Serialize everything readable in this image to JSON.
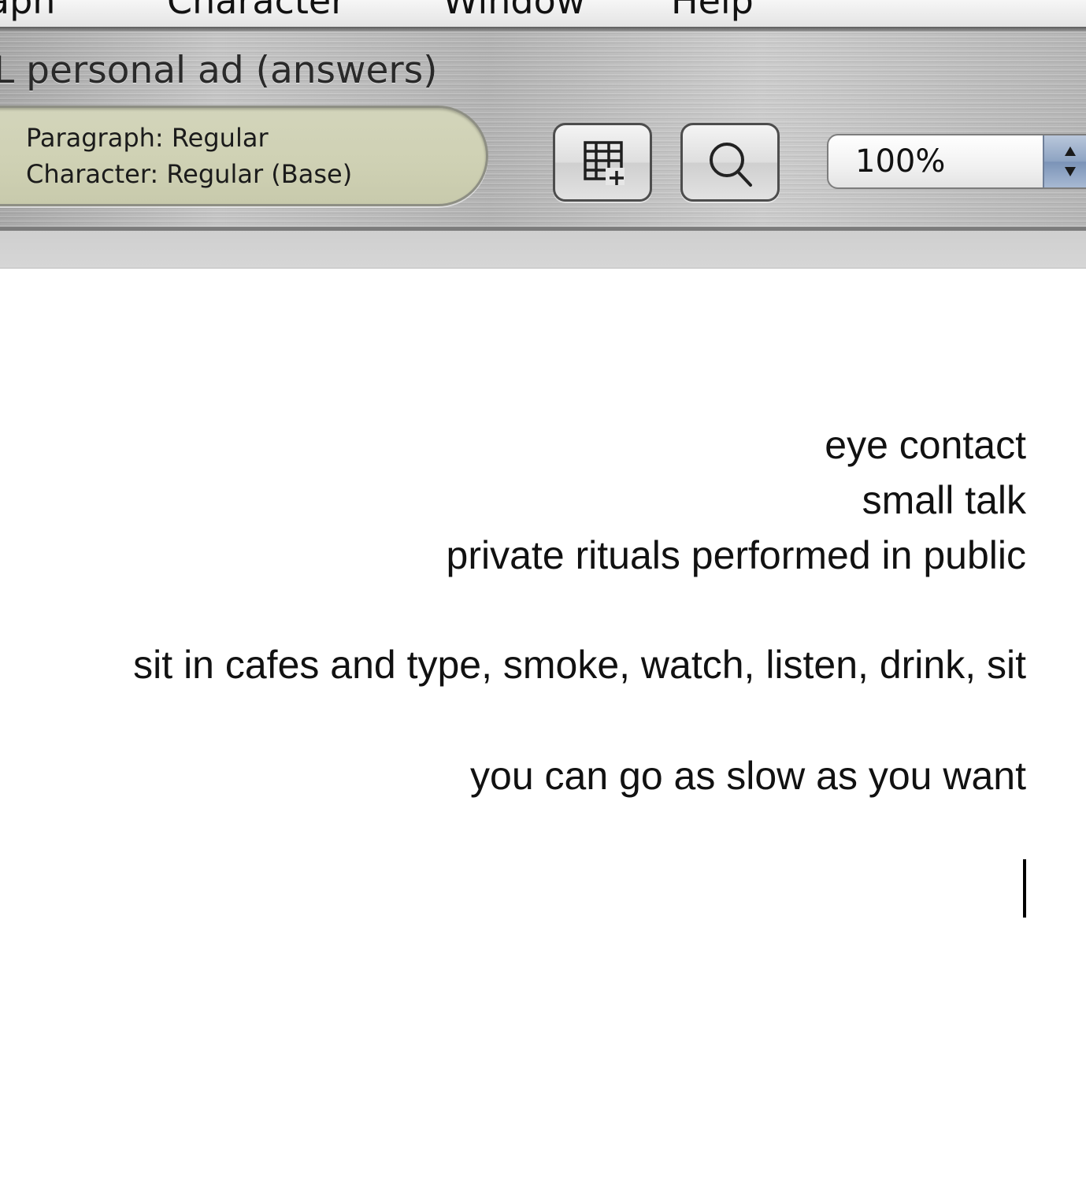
{
  "menu": {
    "items": [
      "raph",
      "Character",
      "Window",
      "Help"
    ]
  },
  "window": {
    "title": "L personal ad (answers)"
  },
  "toolbar": {
    "style_pill": {
      "paragraph": "Paragraph: Regular",
      "character": "Character: Regular (Base)"
    },
    "buttons": [
      {
        "icon": "table-insert-icon"
      },
      {
        "icon": "search-icon"
      }
    ],
    "zoom": {
      "value": "100%"
    }
  },
  "document": {
    "lines": [
      "eye contact",
      "small talk",
      "private rituals performed in public",
      "sit in cafes and type, smoke, watch, listen, drink, sit",
      "you can go as slow as you want"
    ]
  },
  "colors": {
    "pill_background": "#d1d3b7",
    "chrome_metal": "#bdbdbd",
    "page_background": "#ffffff",
    "stepper_blue": "#8da3c2"
  }
}
